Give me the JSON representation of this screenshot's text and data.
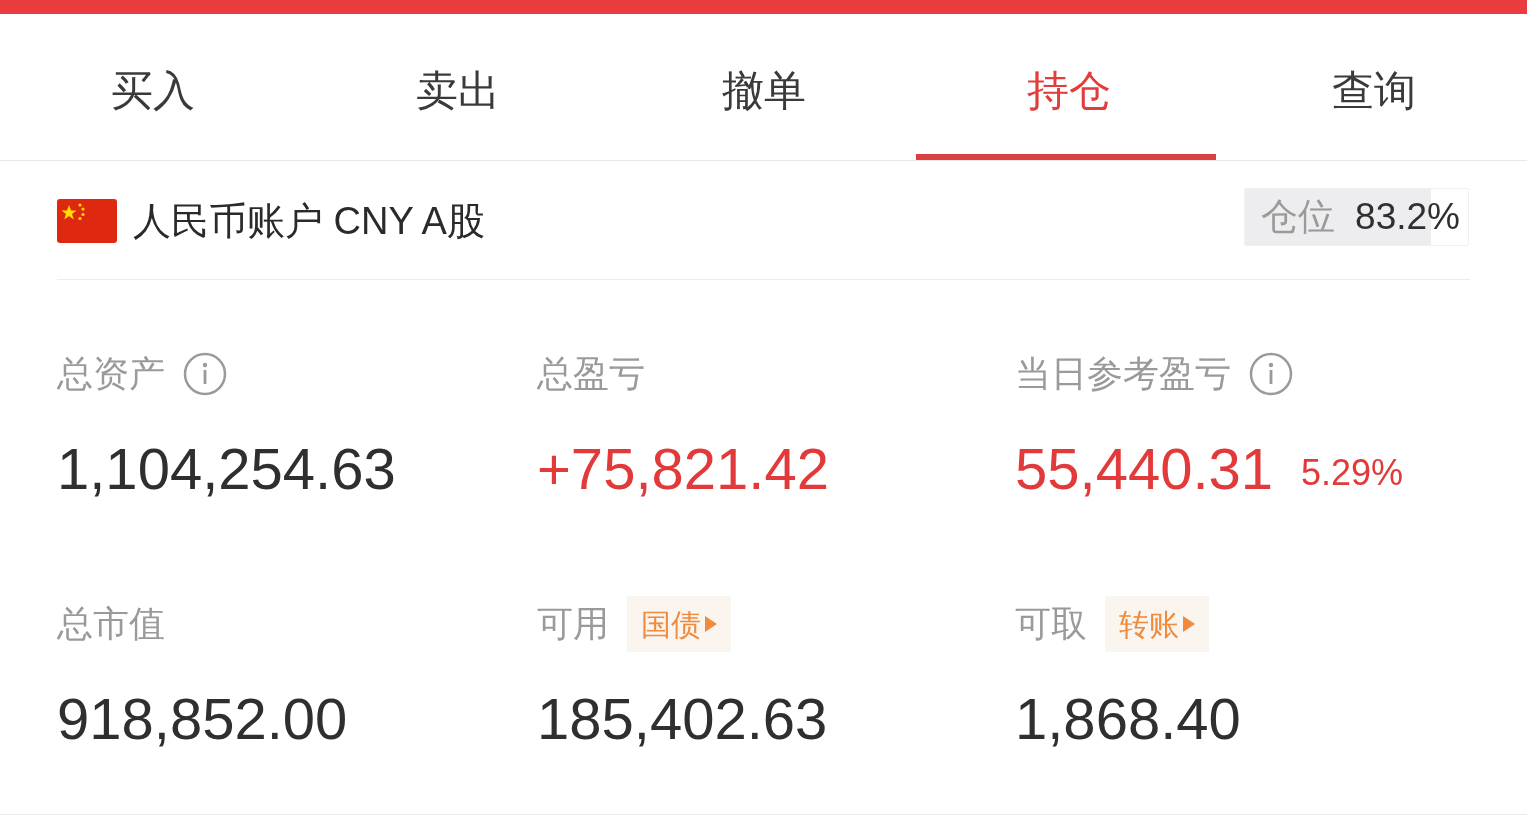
{
  "tabs": [
    {
      "label": "买入",
      "selected": false
    },
    {
      "label": "卖出",
      "selected": false
    },
    {
      "label": "撤单",
      "selected": false
    },
    {
      "label": "持仓",
      "selected": true
    },
    {
      "label": "查询",
      "selected": false
    }
  ],
  "account": {
    "name": "人民币账户 CNY A股",
    "position": {
      "label": "仓位",
      "reading": "83.2%",
      "level": 0.832
    }
  },
  "metrics": [
    {
      "label": "总资产",
      "info": true,
      "value": "1,104,254.63",
      "kind": "plain"
    },
    {
      "label": "总盈亏",
      "info": false,
      "value": "+75,821.42",
      "kind": "gain"
    },
    {
      "label": "当日参考盈亏",
      "info": true,
      "value": "55,440.31",
      "kind": "gain",
      "percent": "5.29%"
    },
    {
      "label": "总市值",
      "info": false,
      "value": "918,852.00",
      "kind": "plain"
    },
    {
      "label": "可用",
      "info": false,
      "action": "国债",
      "value": "185,402.63",
      "kind": "plain"
    },
    {
      "label": "可取",
      "info": false,
      "action": "转账",
      "value": "1,868.40",
      "kind": "plain"
    }
  ]
}
